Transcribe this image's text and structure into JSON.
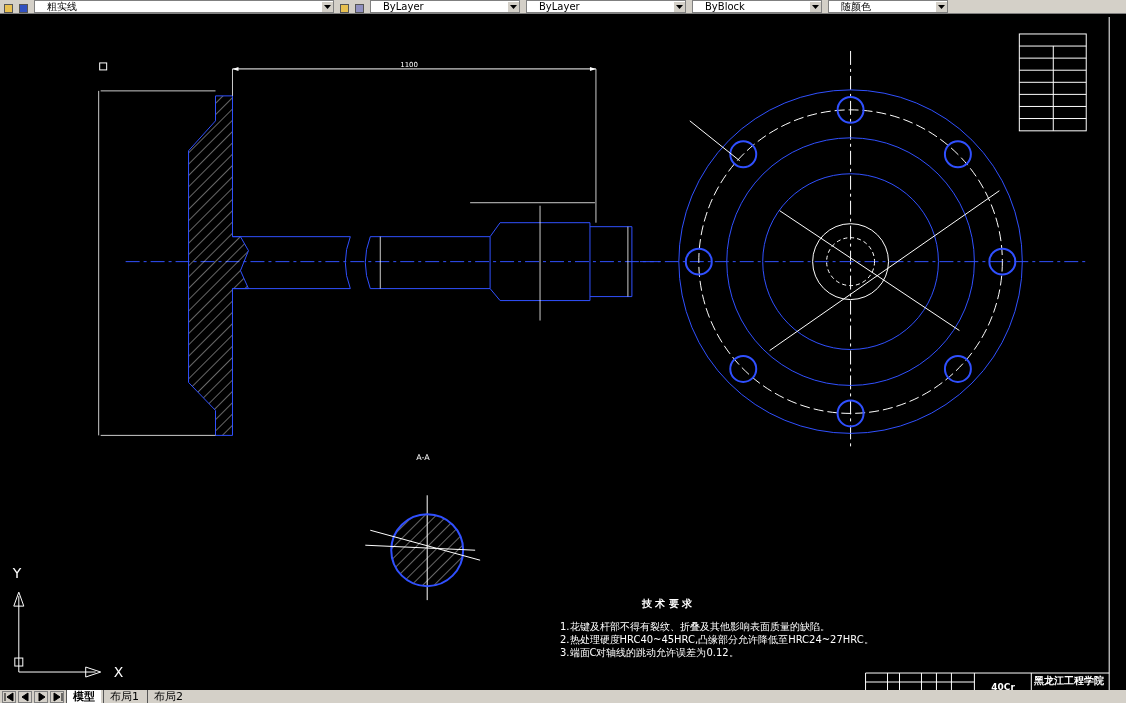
{
  "toolbar": {
    "layer": "粗实线",
    "color_control": "ByLayer",
    "linetype": "ByLayer",
    "lineweight": "ByBlock",
    "plotstyle": "随颜色"
  },
  "drawing": {
    "dimension": "1100",
    "section_label": "A-A",
    "requirements_title": "技 术 要 求",
    "requirements": [
      "1.花键及杆部不得有裂纹、折叠及其他影响表面质量的缺陷。",
      "2.热处理硬度HRC40~45HRC,凸缘部分允许降低至HRC24~27HRC。",
      "3.端面C对轴线的跳动允许误差为0.12。"
    ],
    "school": "黑龙江工程学院",
    "material": "40Cr"
  },
  "ucs": {
    "x": "X",
    "y": "Y"
  },
  "tabs": [
    {
      "label": "模型",
      "selected": true
    },
    {
      "label": "布局1",
      "selected": false
    },
    {
      "label": "布局2",
      "selected": false
    }
  ]
}
